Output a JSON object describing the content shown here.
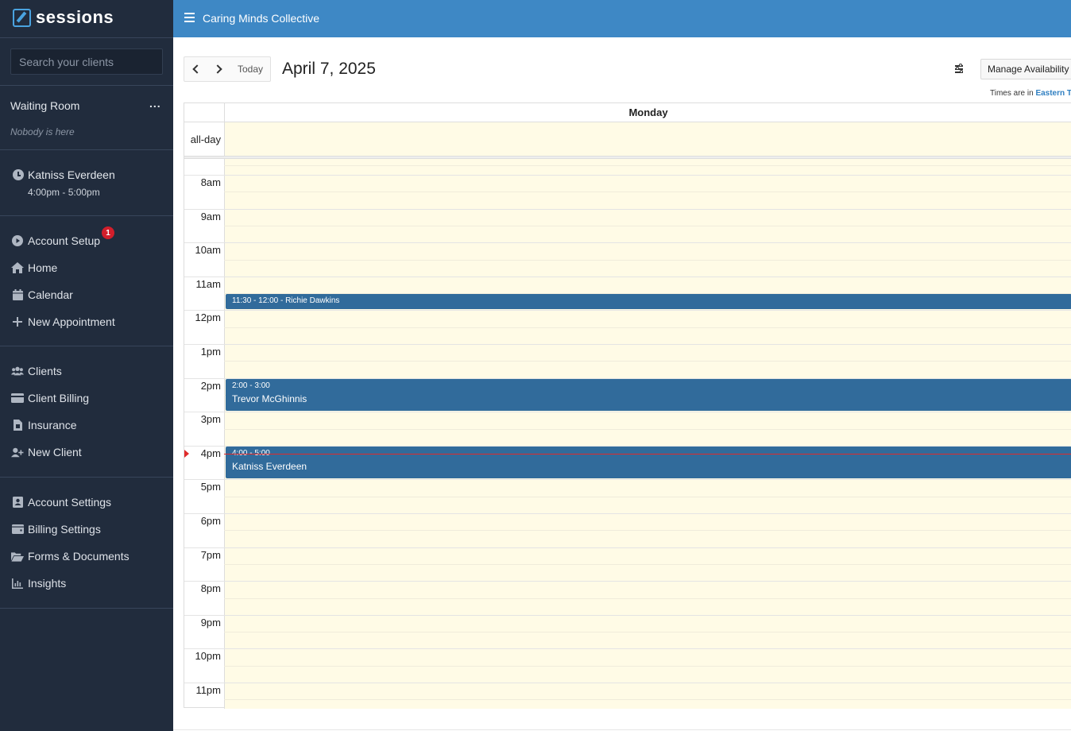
{
  "sidebar": {
    "logo_text": "sessions",
    "search_placeholder": "Search your clients",
    "waiting_room": {
      "title": "Waiting Room",
      "more": "...",
      "empty_text": "Nobody is here"
    },
    "up_next": {
      "name": "Katniss Everdeen",
      "time": "4:00pm - 5:00pm"
    },
    "nav_group_1": [
      {
        "label": "Account Setup",
        "icon": "play-circle-icon",
        "badge": "1"
      },
      {
        "label": "Home",
        "icon": "home-icon"
      },
      {
        "label": "Calendar",
        "icon": "calendar-icon"
      },
      {
        "label": "New Appointment",
        "icon": "plus-icon"
      }
    ],
    "nav_group_2": [
      {
        "label": "Clients",
        "icon": "users-icon"
      },
      {
        "label": "Client Billing",
        "icon": "credit-card-icon"
      },
      {
        "label": "Insurance",
        "icon": "file-invoice-icon"
      },
      {
        "label": "New Client",
        "icon": "user-plus-icon"
      }
    ],
    "nav_group_3": [
      {
        "label": "Account Settings",
        "icon": "address-book-icon"
      },
      {
        "label": "Billing Settings",
        "icon": "wallet-icon"
      },
      {
        "label": "Forms & Documents",
        "icon": "folder-open-icon"
      },
      {
        "label": "Insights",
        "icon": "chart-icon"
      }
    ]
  },
  "header": {
    "practice_name": "Caring Minds Collective"
  },
  "toolbar": {
    "today_label": "Today",
    "date_title": "April 7, 2025",
    "manage_label": "Manage Availability",
    "tz_prefix": "Times are in",
    "tz_link": "Eastern T"
  },
  "calendar": {
    "day_header": "Monday",
    "allday_label": "all-day",
    "time_labels": [
      "8am",
      "9am",
      "10am",
      "11am",
      "12pm",
      "1pm",
      "2pm",
      "3pm",
      "4pm",
      "5pm",
      "6pm",
      "7pm",
      "8pm",
      "9pm",
      "10pm",
      "11pm"
    ],
    "events": [
      {
        "time": "11:30 - 12:00",
        "name": "Richie Dawkins",
        "inline_label": "11:30 - 12:00 - Richie Dawkins"
      },
      {
        "time": "2:00 - 3:00",
        "name": "Trevor McGhinnis"
      },
      {
        "time": "4:00 - 5:00",
        "name": "Katniss Everdeen"
      }
    ]
  }
}
